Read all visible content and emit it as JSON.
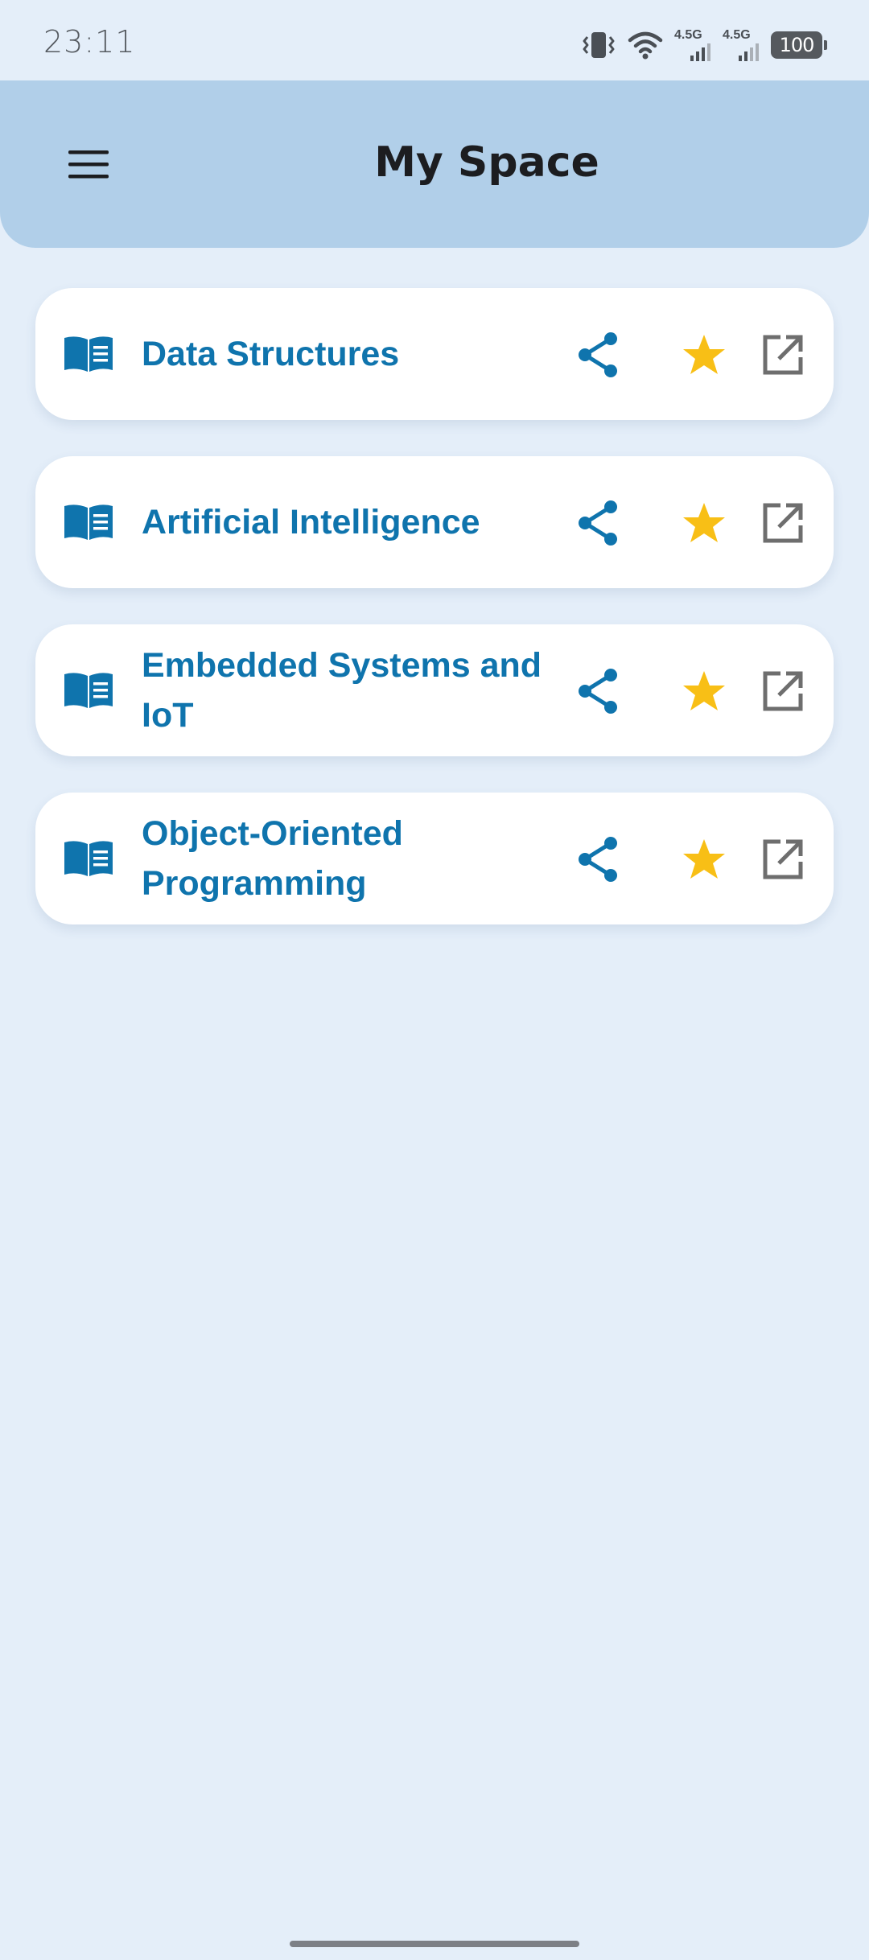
{
  "status_bar": {
    "time": "23:11",
    "network_1": "4.5G",
    "network_2": "4.5G",
    "battery": "100",
    "icons": [
      "vibrate-icon",
      "wifi-icon",
      "signal-icon",
      "signal-icon",
      "battery-icon"
    ]
  },
  "app_bar": {
    "title": "My Space",
    "menu_icon": "menu-icon"
  },
  "colors": {
    "background": "#e4eef9",
    "app_bar": "#b1cfe9",
    "title_blue": "#0f74ad",
    "star": "#f8bf16",
    "open_icon": "#6e6e6e"
  },
  "subjects": [
    {
      "title": "Data Structures",
      "icon": "book-icon",
      "favorite": true
    },
    {
      "title": "Artificial Intelligence",
      "icon": "book-icon",
      "favorite": true
    },
    {
      "title": "Embedded Systems and IoT",
      "icon": "book-icon",
      "favorite": true
    },
    {
      "title": "Object-Oriented Programming",
      "icon": "book-icon",
      "favorite": true
    }
  ]
}
